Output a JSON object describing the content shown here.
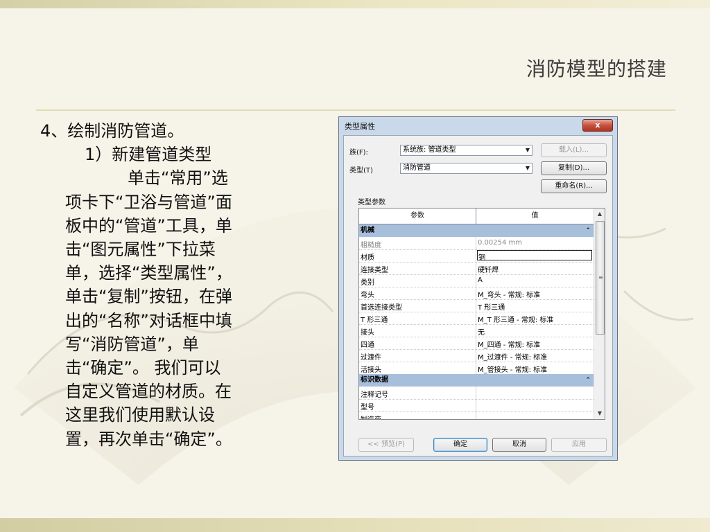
{
  "slide": {
    "title": "消防模型的搭建",
    "heading": "4、绘制消防管道。",
    "subheading": "1）新建管道类型",
    "paragraph_lines": [
      "单击“常用”选",
      "项卡下“卫浴与管道”面",
      "板中的“管道”工具，单",
      "击“图元属性”下拉菜",
      "单，选择“类型属性”，",
      "单击“复制”按钮，在弹",
      "出的“名称”对话框中填",
      "写“消防管道”，单",
      "击“确定”。  我们可以",
      "自定义管道的材质。在",
      "这里我们使用默认设",
      "置，再次单击“确定”。"
    ]
  },
  "dialog": {
    "title": "类型属性",
    "close_label": "x",
    "family_label": "族(F):",
    "family_value": "系统族: 管道类型",
    "type_label": "类型(T)",
    "type_value": "消防管道",
    "load_button": "载入(L)...",
    "duplicate_button": "复制(D)...",
    "rename_button": "重命名(R)...",
    "type_params_label": "类型参数",
    "col_param": "参数",
    "col_value": "值",
    "groups": [
      {
        "name": "机械",
        "rows": [
          {
            "param": "粗糙度",
            "value": "0.00254 mm",
            "dim": true
          },
          {
            "param": "材质",
            "value": "铜",
            "editing": true
          },
          {
            "param": "连接类型",
            "value": "硬钎焊"
          },
          {
            "param": "类别",
            "value": "A"
          },
          {
            "param": "弯头",
            "value": "M_弯头 - 常规: 标准"
          },
          {
            "param": "首选连接类型",
            "value": "T 形三通"
          },
          {
            "param": "T 形三通",
            "value": "M_T 形三通 - 常规: 标准"
          },
          {
            "param": "接头",
            "value": "无"
          },
          {
            "param": "四通",
            "value": "M_四通 - 常规: 标准"
          },
          {
            "param": "过渡件",
            "value": "M_过渡件 - 常规: 标准"
          },
          {
            "param": "活接头",
            "value": "M_管接头 - 常规: 标准"
          }
        ]
      },
      {
        "name": "标识数据",
        "rows": [
          {
            "param": "注释记号",
            "value": ""
          },
          {
            "param": "型号",
            "value": ""
          },
          {
            "param": "制造商",
            "value": ""
          }
        ]
      }
    ],
    "preview_button": "<< 预览(P)",
    "ok_button": "确定",
    "cancel_button": "取消",
    "apply_button": "应用"
  },
  "colors": {
    "group_header": "#a8bfdc",
    "dialog_frame": "#c9d9ea",
    "close_button": "#c5513f"
  }
}
